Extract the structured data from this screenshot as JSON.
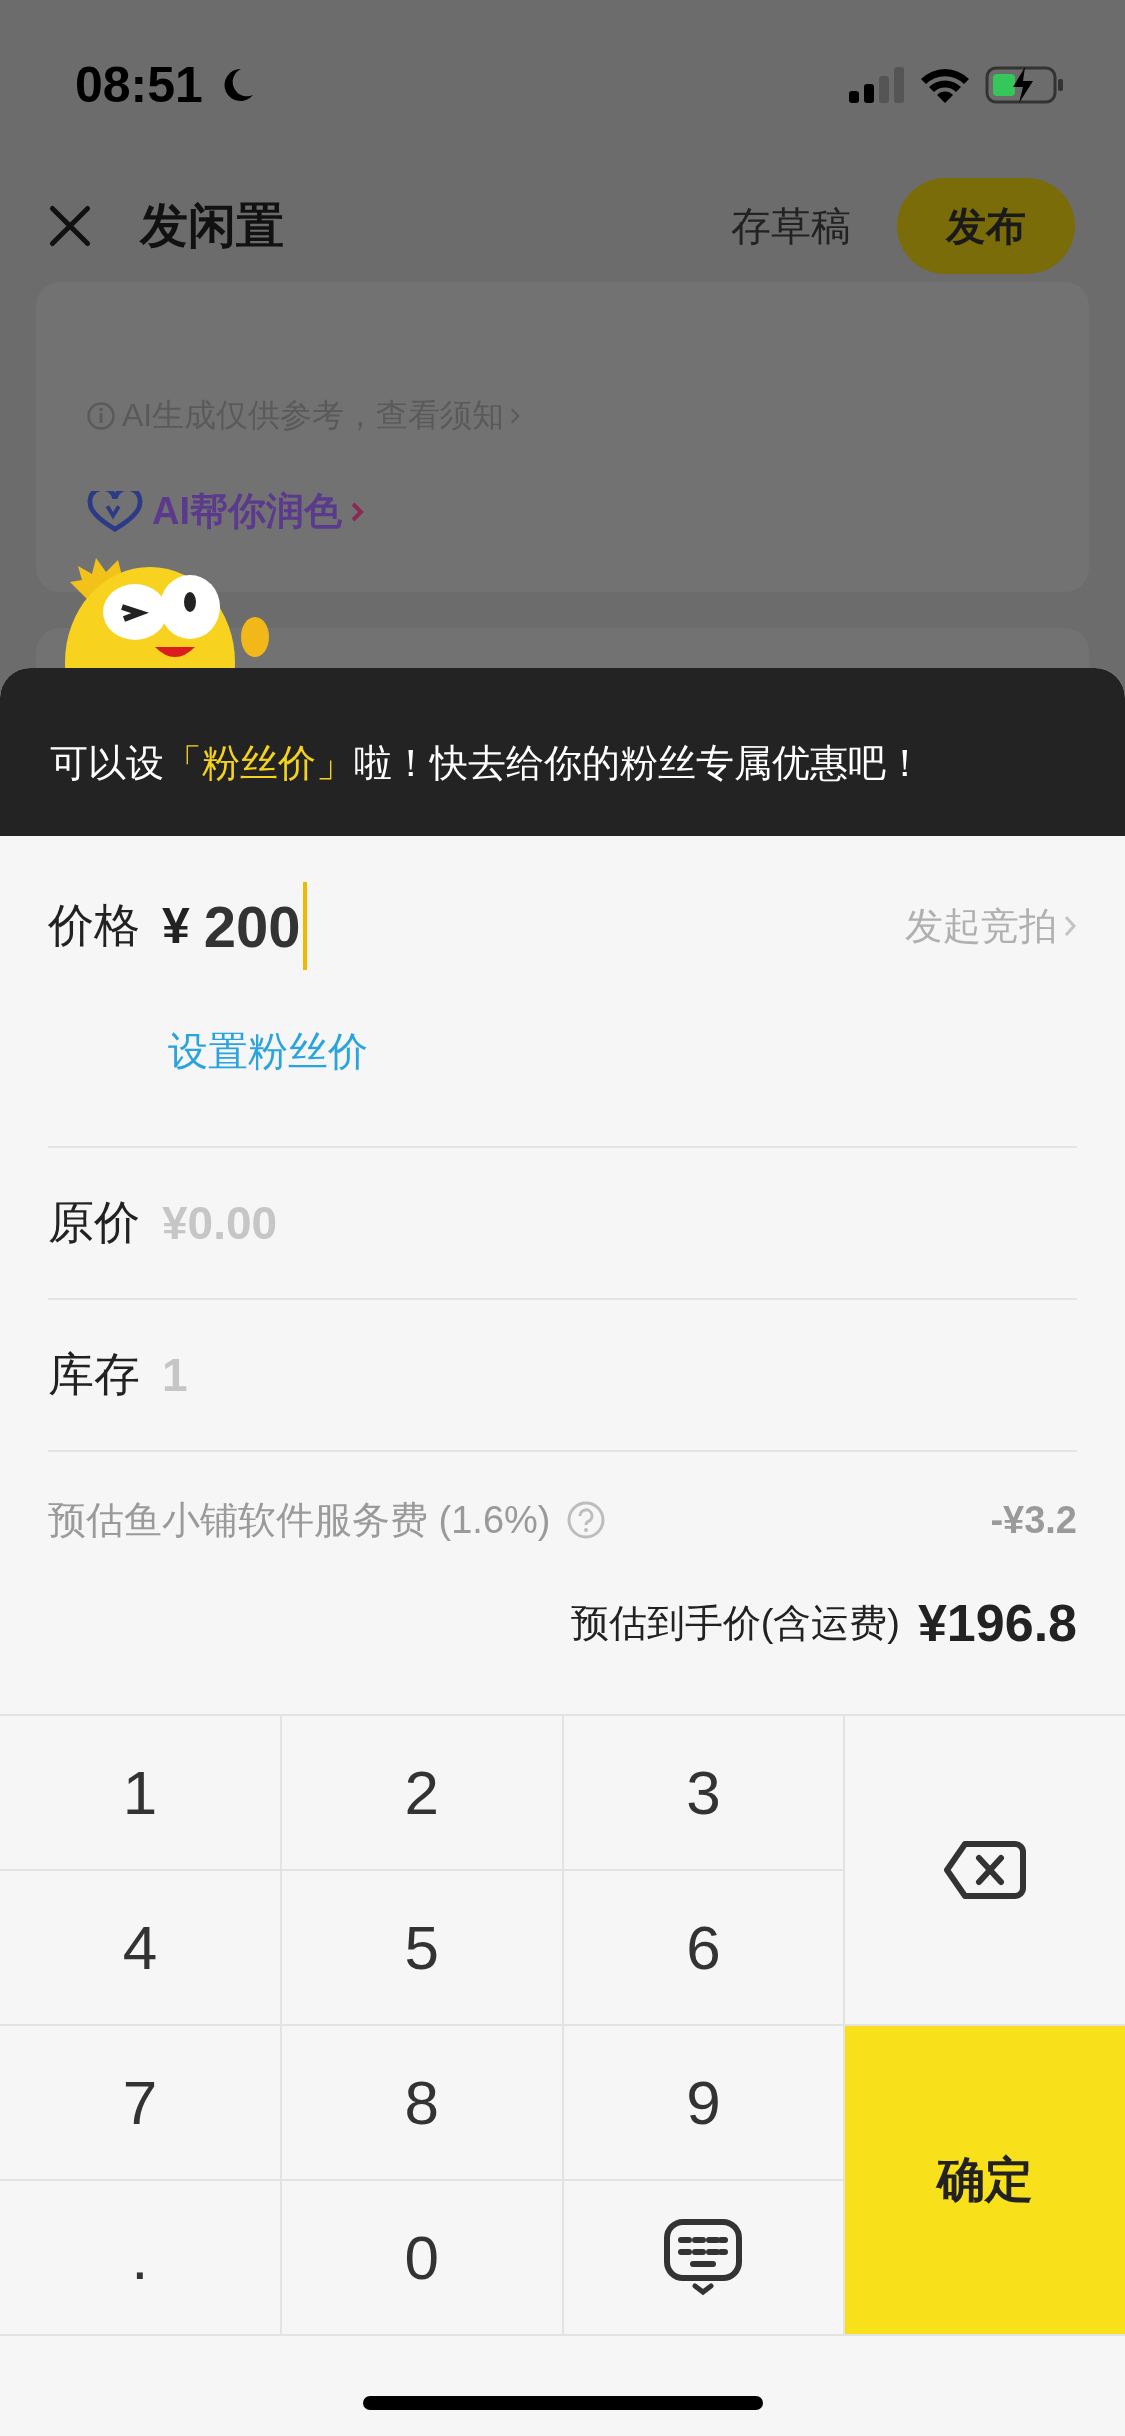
{
  "status_bar": {
    "time": "08:51"
  },
  "header": {
    "title": "发闲置",
    "draft": "存草稿",
    "publish": "发布"
  },
  "ai_card": {
    "notice": "AI生成仅供参考，查看须知",
    "assist": "AI帮你润色"
  },
  "banner": {
    "prefix": "可以设",
    "highlight": "「粉丝价」",
    "suffix": "啦！快去给你的粉丝专属优惠吧！"
  },
  "price": {
    "label": "价格",
    "currency": "¥",
    "value": "200",
    "auction": "发起竞拍",
    "fan_price_link": "设置粉丝价"
  },
  "fields": [
    {
      "label": "原价",
      "placeholder": "¥0.00"
    },
    {
      "label": "库存",
      "placeholder": "1"
    }
  ],
  "fee": {
    "label": "预估鱼小铺软件服务费 (1.6%)",
    "amount": "-¥3.2"
  },
  "net": {
    "label": "预估到手价(含运费)",
    "amount": "¥196.8"
  },
  "keypad": [
    {
      "kind": "digit",
      "label": "1"
    },
    {
      "kind": "digit",
      "label": "2"
    },
    {
      "kind": "digit",
      "label": "3"
    },
    {
      "kind": "delete"
    },
    {
      "kind": "digit",
      "label": "4"
    },
    {
      "kind": "digit",
      "label": "5"
    },
    {
      "kind": "digit",
      "label": "6"
    },
    {
      "kind": "digit",
      "label": "7"
    },
    {
      "kind": "digit",
      "label": "8"
    },
    {
      "kind": "digit",
      "label": "9"
    },
    {
      "kind": "confirm",
      "label": "确定"
    },
    {
      "kind": "digit",
      "label": "."
    },
    {
      "kind": "digit",
      "label": "0"
    },
    {
      "kind": "hide"
    }
  ]
}
